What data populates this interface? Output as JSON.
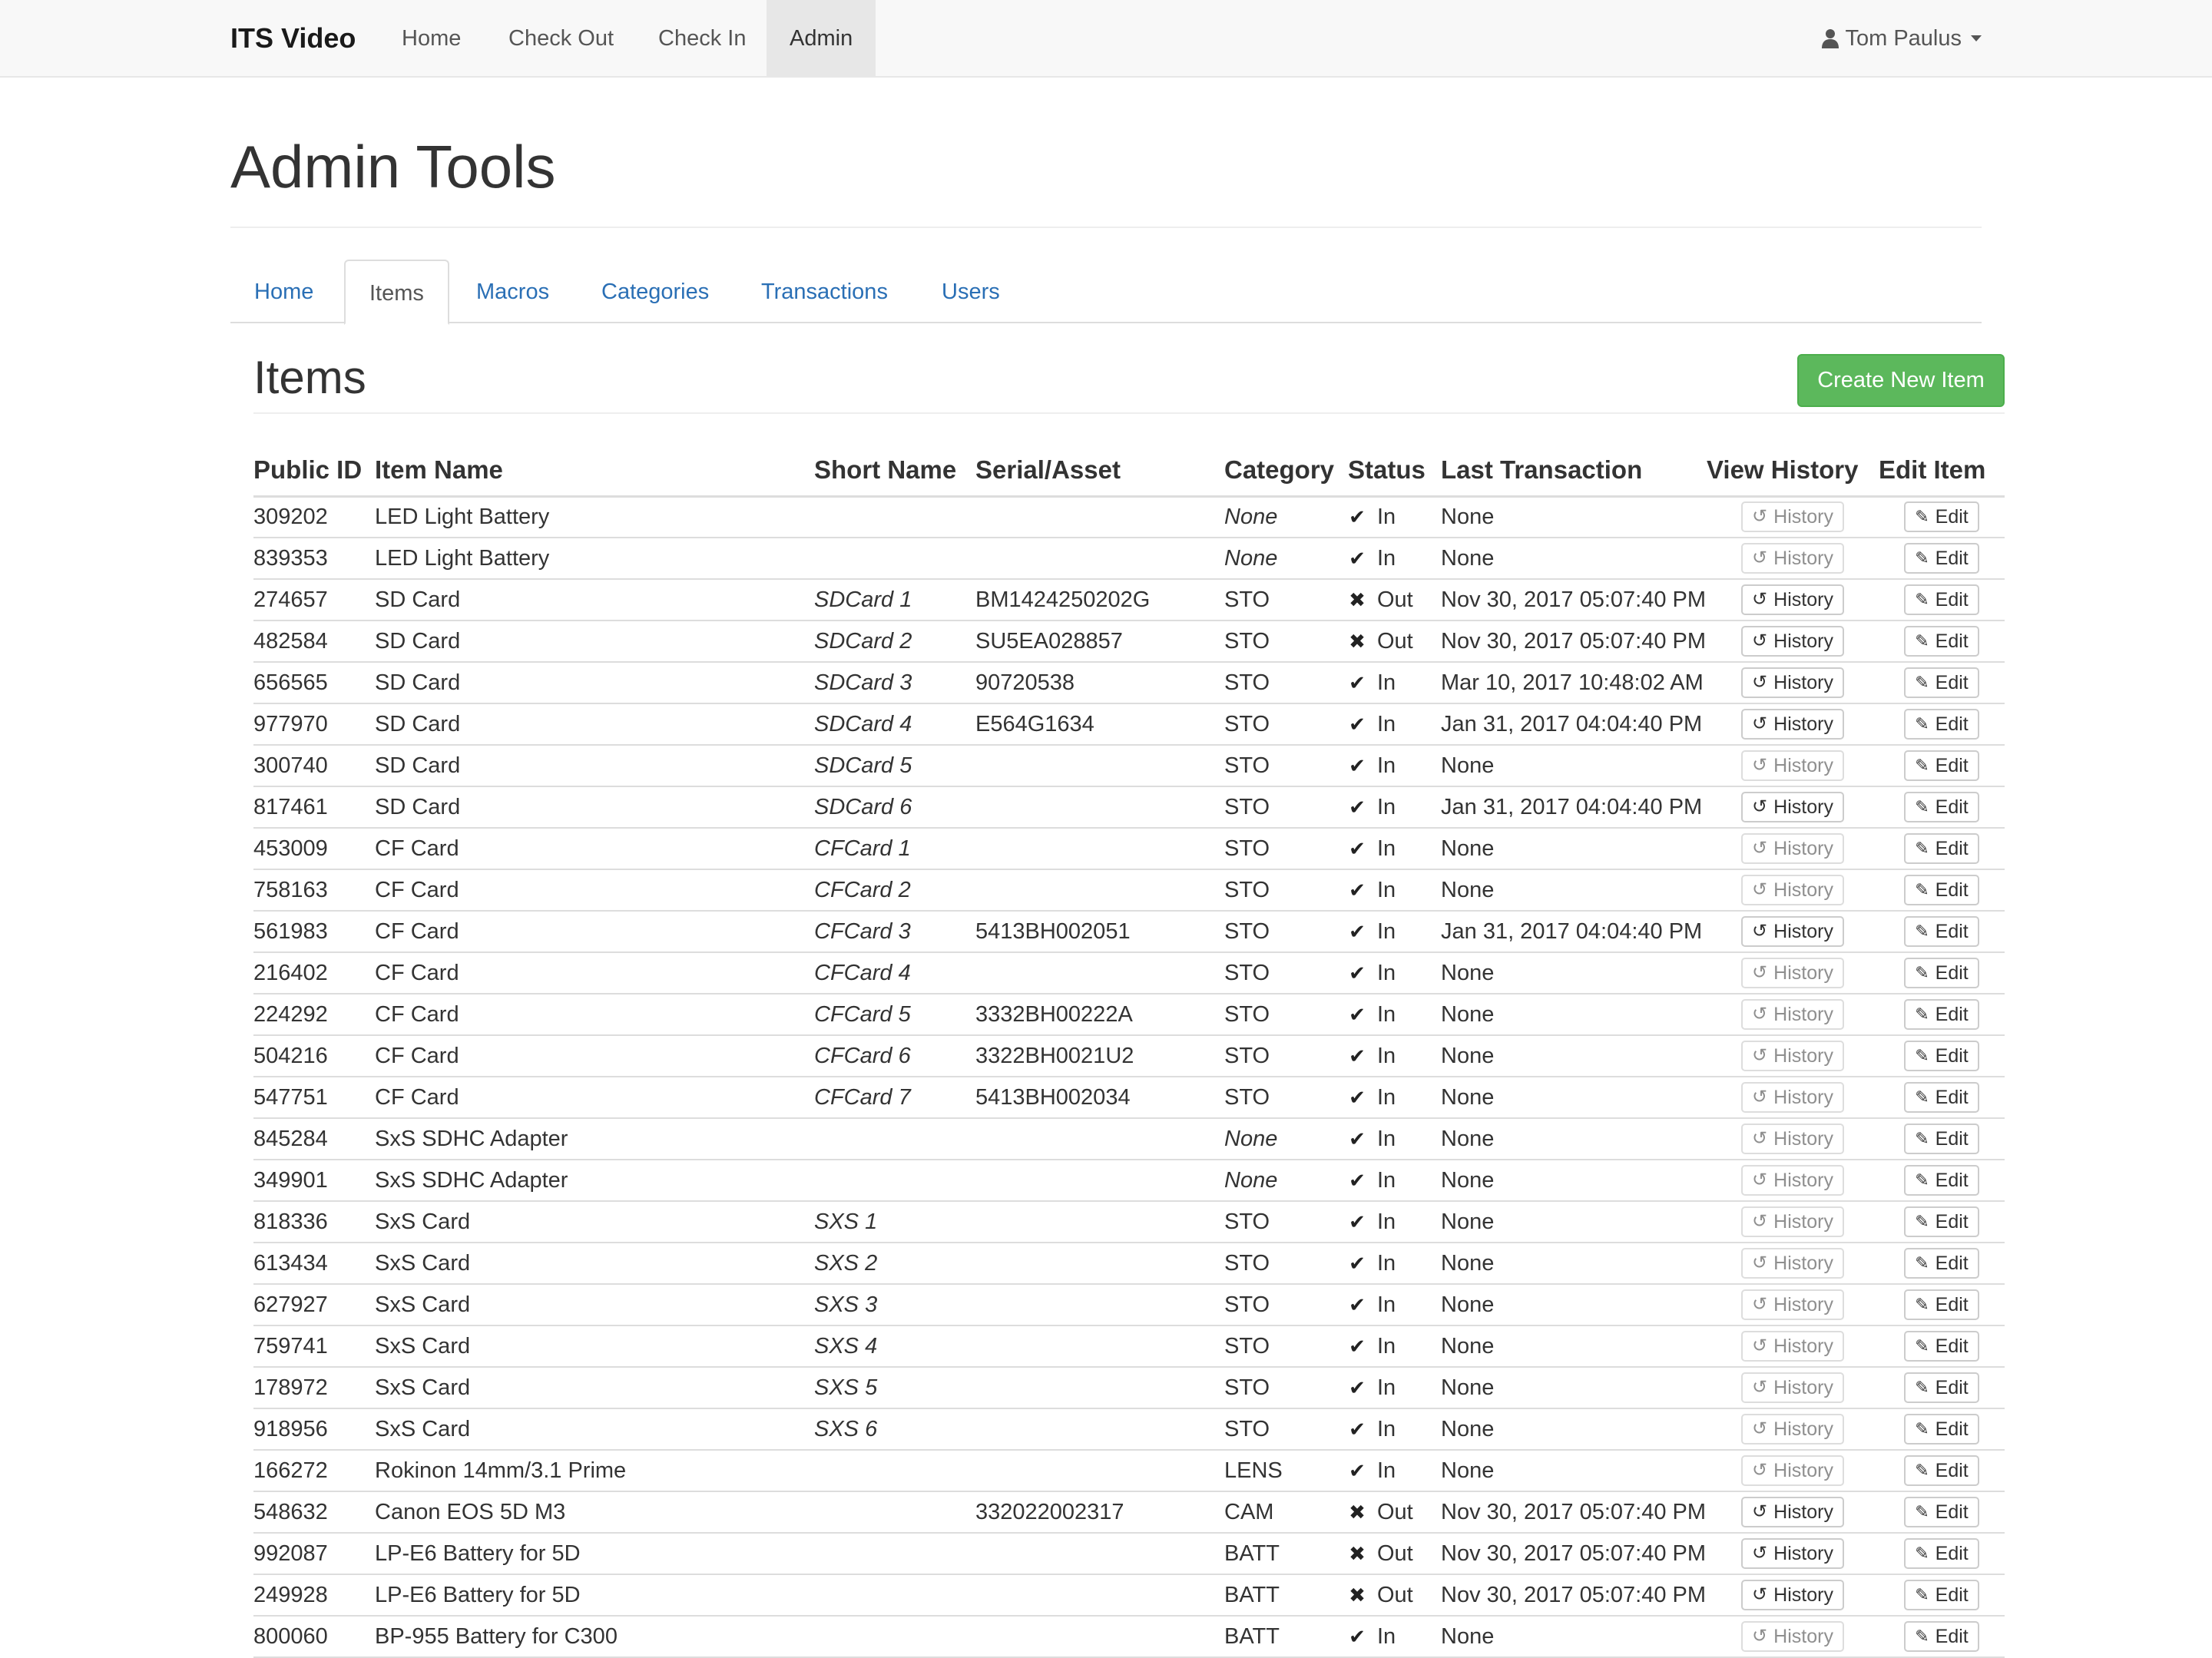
{
  "navbar": {
    "brand": "ITS Video",
    "items": [
      {
        "label": "Home"
      },
      {
        "label": "Check Out"
      },
      {
        "label": "Check In"
      },
      {
        "label": "Admin"
      }
    ],
    "user": "Tom Paulus"
  },
  "page": {
    "title": "Admin Tools",
    "tabs": [
      {
        "label": "Home"
      },
      {
        "label": "Items"
      },
      {
        "label": "Macros"
      },
      {
        "label": "Categories"
      },
      {
        "label": "Transactions"
      },
      {
        "label": "Users"
      }
    ],
    "active_tab": "Items"
  },
  "section": {
    "title": "Items",
    "create_button": "Create New Item"
  },
  "table": {
    "columns": [
      "Public ID",
      "Item Name",
      "Short Name",
      "Serial/Asset",
      "Category",
      "Status",
      "Last Transaction",
      "View History",
      "Edit Item"
    ],
    "history_label": "History",
    "edit_label": "Edit",
    "rows": [
      {
        "id": "309202",
        "name": "LED Light Battery",
        "short": "",
        "serial": "",
        "category": "None",
        "status": "In",
        "last": "None",
        "history_enabled": false
      },
      {
        "id": "839353",
        "name": "LED Light Battery",
        "short": "",
        "serial": "",
        "category": "None",
        "status": "In",
        "last": "None",
        "history_enabled": false
      },
      {
        "id": "274657",
        "name": "SD Card",
        "short": "SDCard 1",
        "serial": "BM1424250202G",
        "category": "STO",
        "status": "Out",
        "last": "Nov 30, 2017 05:07:40 PM",
        "history_enabled": true
      },
      {
        "id": "482584",
        "name": "SD Card",
        "short": "SDCard 2",
        "serial": "SU5EA028857",
        "category": "STO",
        "status": "Out",
        "last": "Nov 30, 2017 05:07:40 PM",
        "history_enabled": true
      },
      {
        "id": "656565",
        "name": "SD Card",
        "short": "SDCard 3",
        "serial": "90720538",
        "category": "STO",
        "status": "In",
        "last": "Mar 10, 2017 10:48:02 AM",
        "history_enabled": true
      },
      {
        "id": "977970",
        "name": "SD Card",
        "short": "SDCard 4",
        "serial": "E564G1634",
        "category": "STO",
        "status": "In",
        "last": "Jan 31, 2017 04:04:40 PM",
        "history_enabled": true
      },
      {
        "id": "300740",
        "name": "SD Card",
        "short": "SDCard 5",
        "serial": "",
        "category": "STO",
        "status": "In",
        "last": "None",
        "history_enabled": false
      },
      {
        "id": "817461",
        "name": "SD Card",
        "short": "SDCard 6",
        "serial": "",
        "category": "STO",
        "status": "In",
        "last": "Jan 31, 2017 04:04:40 PM",
        "history_enabled": true
      },
      {
        "id": "453009",
        "name": "CF Card",
        "short": "CFCard 1",
        "serial": "",
        "category": "STO",
        "status": "In",
        "last": "None",
        "history_enabled": false
      },
      {
        "id": "758163",
        "name": "CF Card",
        "short": "CFCard 2",
        "serial": "",
        "category": "STO",
        "status": "In",
        "last": "None",
        "history_enabled": false
      },
      {
        "id": "561983",
        "name": "CF Card",
        "short": "CFCard 3",
        "serial": "5413BH002051",
        "category": "STO",
        "status": "In",
        "last": "Jan 31, 2017 04:04:40 PM",
        "history_enabled": true
      },
      {
        "id": "216402",
        "name": "CF Card",
        "short": "CFCard 4",
        "serial": "",
        "category": "STO",
        "status": "In",
        "last": "None",
        "history_enabled": false
      },
      {
        "id": "224292",
        "name": "CF Card",
        "short": "CFCard 5",
        "serial": "3332BH00222A",
        "category": "STO",
        "status": "In",
        "last": "None",
        "history_enabled": false
      },
      {
        "id": "504216",
        "name": "CF Card",
        "short": "CFCard 6",
        "serial": "3322BH0021U2",
        "category": "STO",
        "status": "In",
        "last": "None",
        "history_enabled": false
      },
      {
        "id": "547751",
        "name": "CF Card",
        "short": "CFCard 7",
        "serial": "5413BH002034",
        "category": "STO",
        "status": "In",
        "last": "None",
        "history_enabled": false
      },
      {
        "id": "845284",
        "name": "SxS SDHC Adapter",
        "short": "",
        "serial": "",
        "category": "None",
        "status": "In",
        "last": "None",
        "history_enabled": false
      },
      {
        "id": "349901",
        "name": "SxS SDHC Adapter",
        "short": "",
        "serial": "",
        "category": "None",
        "status": "In",
        "last": "None",
        "history_enabled": false
      },
      {
        "id": "818336",
        "name": "SxS Card",
        "short": "SXS 1",
        "serial": "",
        "category": "STO",
        "status": "In",
        "last": "None",
        "history_enabled": false
      },
      {
        "id": "613434",
        "name": "SxS Card",
        "short": "SXS 2",
        "serial": "",
        "category": "STO",
        "status": "In",
        "last": "None",
        "history_enabled": false
      },
      {
        "id": "627927",
        "name": "SxS Card",
        "short": "SXS 3",
        "serial": "",
        "category": "STO",
        "status": "In",
        "last": "None",
        "history_enabled": false
      },
      {
        "id": "759741",
        "name": "SxS Card",
        "short": "SXS 4",
        "serial": "",
        "category": "STO",
        "status": "In",
        "last": "None",
        "history_enabled": false
      },
      {
        "id": "178972",
        "name": "SxS Card",
        "short": "SXS 5",
        "serial": "",
        "category": "STO",
        "status": "In",
        "last": "None",
        "history_enabled": false
      },
      {
        "id": "918956",
        "name": "SxS Card",
        "short": "SXS 6",
        "serial": "",
        "category": "STO",
        "status": "In",
        "last": "None",
        "history_enabled": false
      },
      {
        "id": "166272",
        "name": "Rokinon 14mm/3.1 Prime",
        "short": "",
        "serial": "",
        "category": "LENS",
        "status": "In",
        "last": "None",
        "history_enabled": false
      },
      {
        "id": "548632",
        "name": "Canon EOS 5D M3",
        "short": "",
        "serial": "332022002317",
        "category": "CAM",
        "status": "Out",
        "last": "Nov 30, 2017 05:07:40 PM",
        "history_enabled": true
      },
      {
        "id": "992087",
        "name": "LP-E6 Battery for 5D",
        "short": "",
        "serial": "",
        "category": "BATT",
        "status": "Out",
        "last": "Nov 30, 2017 05:07:40 PM",
        "history_enabled": true
      },
      {
        "id": "249928",
        "name": "LP-E6 Battery for 5D",
        "short": "",
        "serial": "",
        "category": "BATT",
        "status": "Out",
        "last": "Nov 30, 2017 05:07:40 PM",
        "history_enabled": true
      },
      {
        "id": "800060",
        "name": "BP-955 Battery for C300",
        "short": "",
        "serial": "",
        "category": "BATT",
        "status": "In",
        "last": "None",
        "history_enabled": false
      }
    ]
  }
}
